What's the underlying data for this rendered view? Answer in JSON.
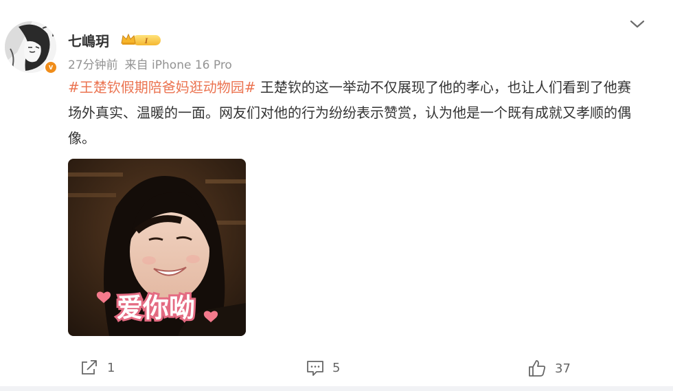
{
  "post": {
    "username": "七嶋玥",
    "vip_level": "I",
    "time": "27分钟前",
    "source": "来自 iPhone 16 Pro",
    "hashtag": "#王楚钦假期陪爸妈逛动物园#",
    "body": " 王楚钦的这一举动不仅展现了他的孝心，也让人们看到了他赛场外真实、温暖的一面。网友们对他的行为纷纷表示赞赏，认为他是一个既有成就又孝顺的偶像。",
    "image_caption": "爱你呦",
    "verified_badge": "v",
    "more_icon": "chevron-down-icon"
  },
  "actions": {
    "repost_count": "1",
    "comment_count": "5",
    "like_count": "37"
  },
  "colors": {
    "hashtag": "#eb7350",
    "verified": "#f08d1a",
    "meta": "#939393"
  }
}
